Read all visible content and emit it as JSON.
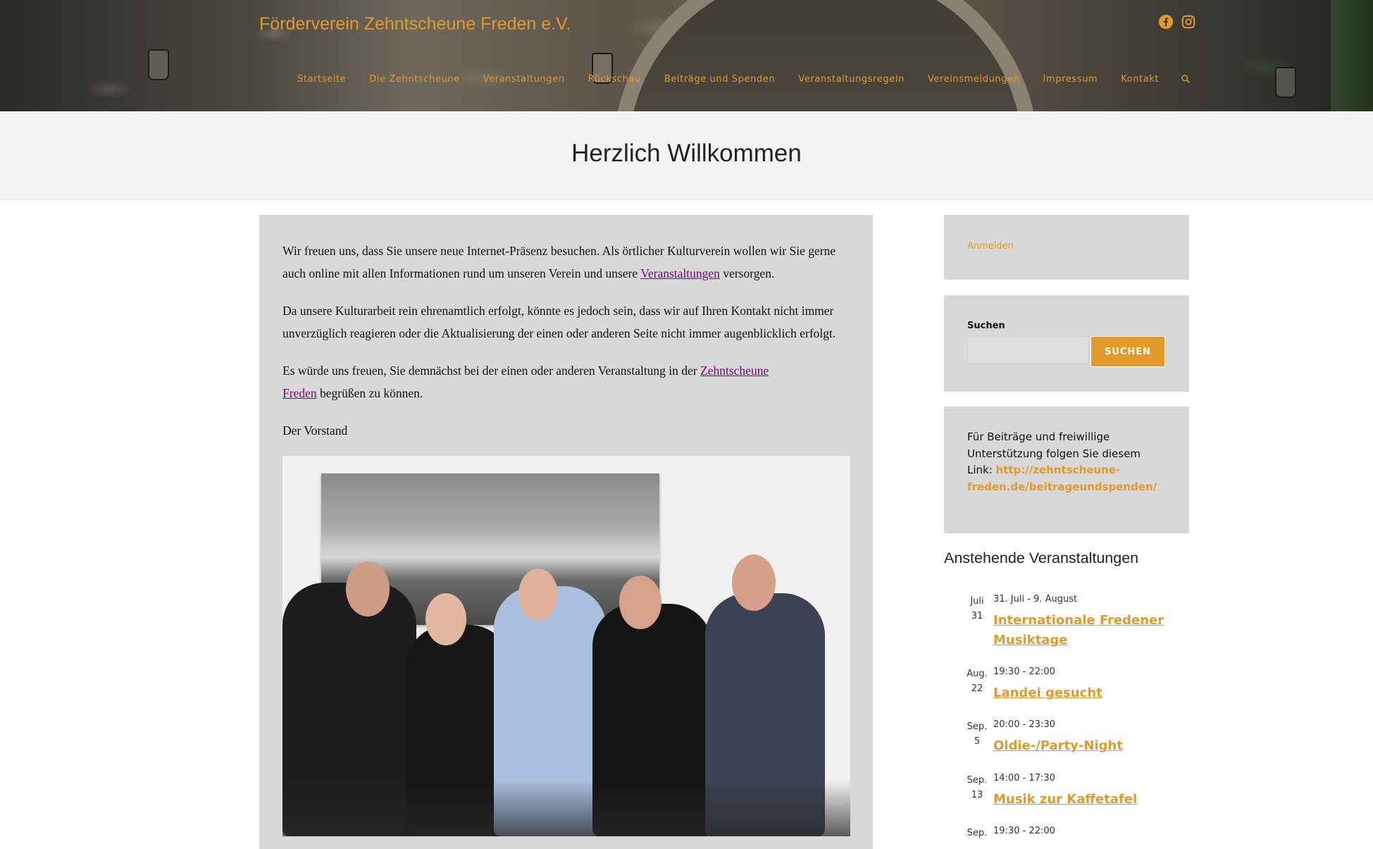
{
  "site": {
    "title": "Förderverein Zehntscheune Freden e.V."
  },
  "social": [
    "facebook-icon",
    "instagram-icon"
  ],
  "nav": {
    "items": [
      "Startseite",
      "Die Zehntscheune",
      "Veranstaltungen",
      "Rückschau",
      "Beiträge und Spenden",
      "Veranstaltungsregeln",
      "Vereinsmeldungen",
      "Impressum",
      "Kontakt"
    ]
  },
  "page": {
    "title": "Herzlich Willkommen"
  },
  "content": {
    "p1_a": "Wir freuen uns, dass Sie unsere neue Internet-Präsenz besuchen. Als örtlicher Kulturverein wollen wir Sie gerne auch online mit allen Informationen rund um unseren Verein und unsere ",
    "p1_link": "Veranstaltungen",
    "p1_b": " versorgen.",
    "p2": "Da unsere Kulturarbeit rein ehrenamtlich erfolgt, könnte es jedoch sein, dass wir auf Ihren Kontakt nicht immer unverzüglich reagieren oder die Aktualisierung der einen oder anderen Seite nicht immer augenblicklich erfolgt.",
    "p3_a": "Es würde uns freuen, Sie demnächst bei der einen oder anderen Veranstaltung in der ",
    "p3_link": "Zehntscheune Freden",
    "p3_b": " begrüßen zu können.",
    "p4": "Der Vorstand"
  },
  "sidebar": {
    "login": "Anmelden",
    "search": {
      "label": "Suchen",
      "value": "",
      "button": "SUCHEN"
    },
    "support": {
      "text": "Für Beiträge und freiwillige Unterstützung folgen Sie diesem Link: ",
      "link": "http://zehntscheune-freden.de/beitrageundspenden/"
    },
    "events_title": "Anstehende Veranstaltungen",
    "events": [
      {
        "month": "Juli",
        "day": "31",
        "time": "31. Juli - 9. August",
        "title": "Internationale Fredener Musiktage"
      },
      {
        "month": "Aug.",
        "day": "22",
        "time": "19:30 - 22:00",
        "title": "Landei gesucht"
      },
      {
        "month": "Sep.",
        "day": "5",
        "time": "20:00 - 23:30",
        "title": "Oldie-/Party-Night"
      },
      {
        "month": "Sep.",
        "day": "13",
        "time": "14:00 - 17:30",
        "title": "Musik zur Kaffetafel"
      },
      {
        "month": "Sep.",
        "day": "",
        "time": "19:30 - 22:00",
        "title": ""
      }
    ]
  },
  "colors": {
    "accent": "#e29a2d",
    "link_visited": "#800080",
    "panel": "#d8d8d8",
    "title_bar": "#f4f4f4"
  }
}
